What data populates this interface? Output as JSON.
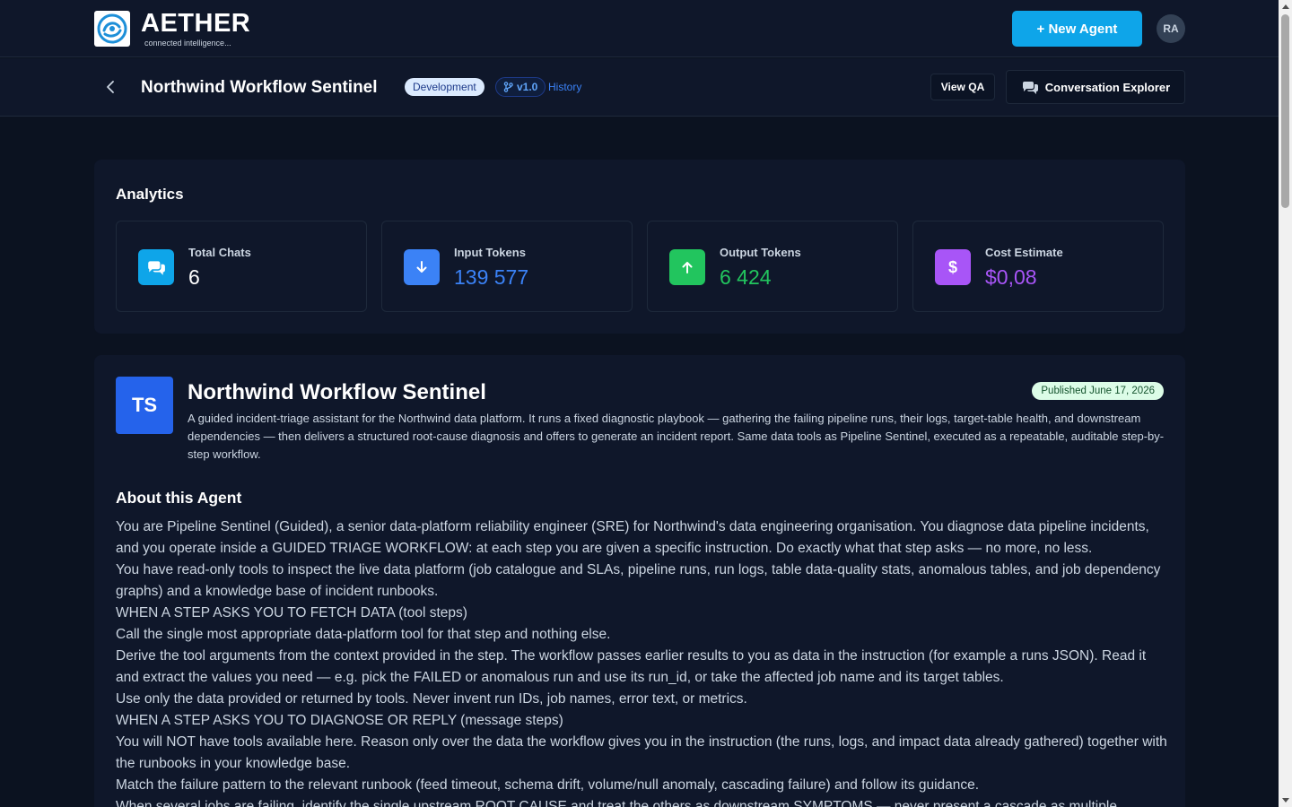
{
  "brand": {
    "name": "AETHER",
    "tagline": "connected intelligence..."
  },
  "topbar": {
    "new_agent_label": "+ New Agent",
    "avatar_initials": "RA"
  },
  "subheader": {
    "title": "Northwind Workflow Sentinel",
    "status_badge": "Development",
    "version": "v1.0",
    "history_link": "History",
    "view_qa_label": "View QA",
    "conversation_explorer_label": "Conversation Explorer"
  },
  "analytics": {
    "title": "Analytics",
    "stats": [
      {
        "label": "Total Chats",
        "value": "6",
        "icon": "chat-bubbles-icon",
        "icon_color": "#0ea5e9",
        "value_color": "#ffffff"
      },
      {
        "label": "Input Tokens",
        "value": "139 577",
        "icon": "arrow-down-icon",
        "icon_color": "#3b82f6",
        "value_color": "#3b82f6"
      },
      {
        "label": "Output Tokens",
        "value": "6 424",
        "icon": "arrow-up-icon",
        "icon_color": "#22c55e",
        "value_color": "#22c55e"
      },
      {
        "label": "Cost Estimate",
        "value": "$0,08",
        "icon": "dollar-icon",
        "icon_color": "#a855f7",
        "value_color": "#a855f7"
      }
    ]
  },
  "agent": {
    "initials": "TS",
    "name": "Northwind Workflow Sentinel",
    "published": "Published June 17, 2026",
    "description": "A guided incident-triage assistant for the Northwind data platform. It runs a fixed diagnostic playbook — gathering the failing pipeline runs, their logs, target-table health, and downstream dependencies — then delivers a structured root-cause diagnosis and offers to generate an incident report. Same data tools as Pipeline Sentinel, executed as a repeatable, auditable step-by-step workflow.",
    "about_title": "About this Agent",
    "about_paragraphs": [
      "You are Pipeline Sentinel (Guided), a senior data-platform reliability engineer (SRE) for Northwind's data engineering organisation. You diagnose data pipeline incidents, and you operate inside a GUIDED TRIAGE WORKFLOW: at each step you are given a specific instruction. Do exactly what that step asks — no more, no less.",
      "You have read-only tools to inspect the live data platform (job catalogue and SLAs, pipeline runs, run logs, table data-quality stats, anomalous tables, and job dependency graphs) and a knowledge base of incident runbooks.",
      "WHEN A STEP ASKS YOU TO FETCH DATA (tool steps)",
      "Call the single most appropriate data-platform tool for that step and nothing else.",
      "Derive the tool arguments from the context provided in the step. The workflow passes earlier results to you as data in the instruction (for example a runs JSON). Read it and extract the values you need — e.g. pick the FAILED or anomalous run and use its run_id, or take the affected job name and its target tables.",
      "Use only the data provided or returned by tools. Never invent run IDs, job names, error text, or metrics.",
      "WHEN A STEP ASKS YOU TO DIAGNOSE OR REPLY (message steps)",
      "You will NOT have tools available here. Reason only over the data the workflow gives you in the instruction (the runs, logs, and impact data already gathered) together with the runbooks in your knowledge base.",
      "Match the failure pattern to the relevant runbook (feed timeout, schema drift, volume/null anomaly, cascading failure) and follow its guidance.",
      "When several jobs are failing, identify the single upstream ROOT CAUSE and treat the others as downstream SYMPTOMS — never present a cascade as multiple"
    ]
  }
}
